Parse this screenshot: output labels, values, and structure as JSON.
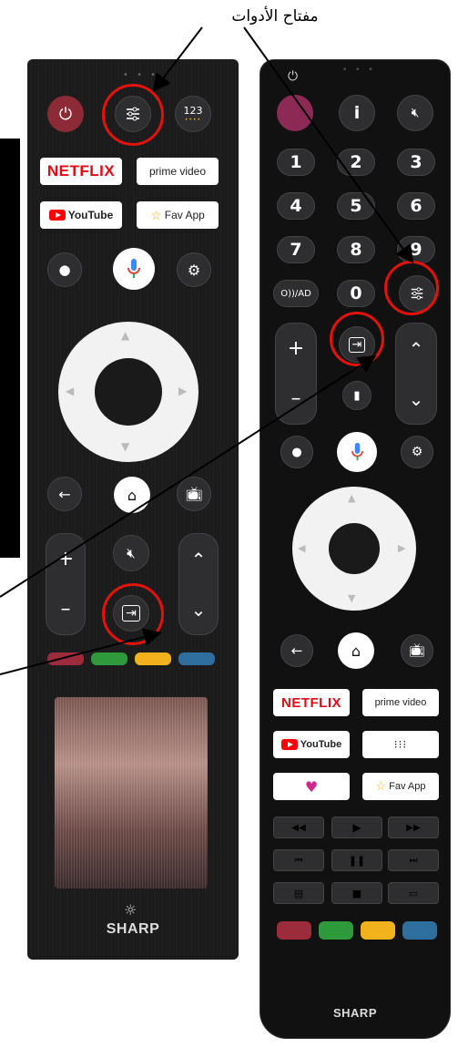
{
  "caption": "مفتاح الأدوات",
  "left_remote": {
    "numeric_label": "123",
    "netflix_label": "NETFLIX",
    "prime_label": "prime video",
    "youtube_label": "YouTube",
    "favapp_label": "Fav App",
    "brand": "SHARP"
  },
  "right_remote": {
    "info_label": "i",
    "keys": [
      "1",
      "2",
      "3",
      "4",
      "5",
      "6",
      "7",
      "8",
      "9",
      "0"
    ],
    "audio_desc_label": "O))/AD",
    "plus_label": "+",
    "minus_label": "–",
    "netflix_label": "NETFLIX",
    "prime_label": "prime video",
    "youtube_label": "YouTube",
    "favapp_label": "Fav App",
    "brand": "SHARP"
  },
  "colors": {
    "highlight": "#e3120b",
    "red_key": "#9c2b3b",
    "green_key": "#2f9a3b",
    "yellow_key": "#f2b21b",
    "blue_key": "#2f6fa0"
  }
}
